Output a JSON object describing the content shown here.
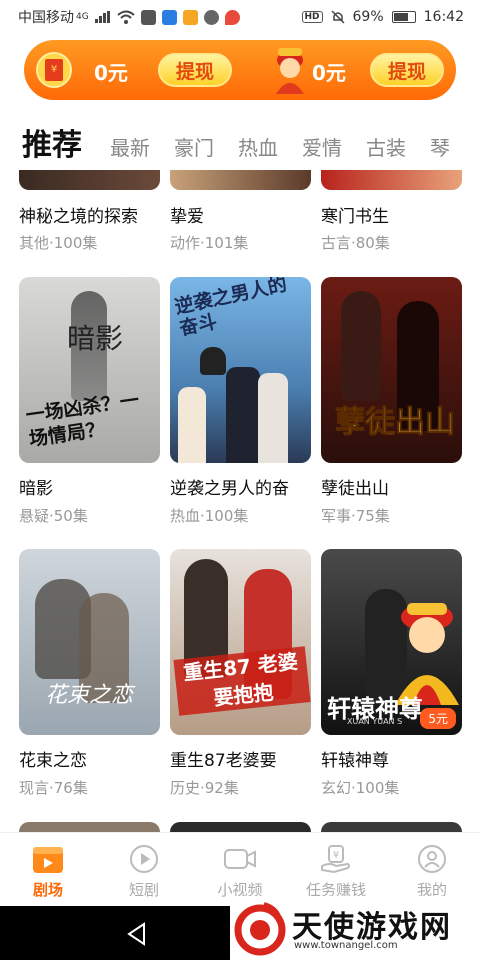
{
  "status_bar": {
    "carrier": "中国移动",
    "net": "4G",
    "battery": "69%",
    "battery_level": 0.69,
    "time": "16:42",
    "hd": "HD"
  },
  "banner": {
    "amount_left": "0元",
    "withdraw_left": "提现",
    "amount_right": "0元",
    "withdraw_right": "提现"
  },
  "tabs": [
    "推荐",
    "最新",
    "豪门",
    "热血",
    "爱情",
    "古装",
    "琴"
  ],
  "rows": [
    [
      {
        "title": "神秘之境的探索",
        "meta": "其他·100集"
      },
      {
        "title": "挚爱",
        "meta": "动作·101集"
      },
      {
        "title": "寒门书生",
        "meta": "古言·80集"
      }
    ],
    [
      {
        "title": "暗影",
        "meta": "悬疑·50集",
        "poster_text": "一场凶杀？一场情局？",
        "poster_title": "暗影"
      },
      {
        "title": "逆袭之男人的奋",
        "meta": "热血·100集",
        "poster_text": "逆袭之男人的奋斗"
      },
      {
        "title": "孽徒出山",
        "meta": "军事·75集",
        "poster_text": "孽徒出山"
      }
    ],
    [
      {
        "title": "花束之恋",
        "meta": "现言·76集",
        "poster_text": "花束之恋"
      },
      {
        "title": "重生87老婆要",
        "meta": "历史·92集",
        "poster_text": "重生87 老婆要抱抱"
      },
      {
        "title": "轩辕神尊",
        "meta": "玄幻·100集",
        "poster_text": "轩辕神尊",
        "price": "5元",
        "poster_sub": "XUAN YUAN S"
      }
    ]
  ],
  "bottom_nav": [
    {
      "label": "剧场",
      "icon": "theater-icon"
    },
    {
      "label": "短剧",
      "icon": "play-icon"
    },
    {
      "label": "小视频",
      "icon": "video-camera-icon"
    },
    {
      "label": "任务赚钱",
      "icon": "money-hand-icon"
    },
    {
      "label": "我的",
      "icon": "profile-icon"
    }
  ],
  "watermark": {
    "text": "天使游戏网",
    "url": "www.townangel.com"
  },
  "colors": {
    "accent": "#ff6a08",
    "banner_start": "#ff9a22",
    "banner_end": "#ff6a08"
  }
}
